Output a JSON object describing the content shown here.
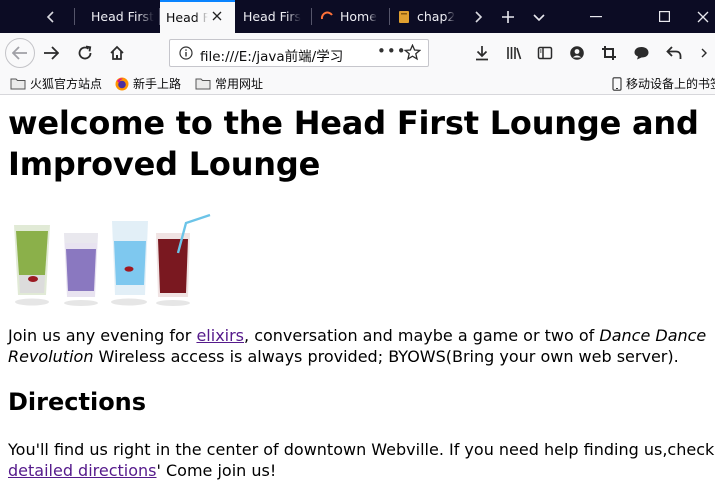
{
  "browser": {
    "tabs": [
      {
        "label": "Head First",
        "active": false
      },
      {
        "label": "Head F",
        "active": true
      },
      {
        "label": "Head Firs",
        "active": false
      },
      {
        "label": "Home",
        "active": false,
        "favicon": "loading-spinner-icon"
      },
      {
        "label": "chap2",
        "active": false,
        "favicon": "book-icon"
      }
    ],
    "url": "file:///E:/java前端/学习",
    "url_overflow": "•••",
    "bookmarks": [
      {
        "label": "火狐官方站点",
        "icon": "folder-icon"
      },
      {
        "label": "新手上路",
        "icon": "firefox-icon"
      },
      {
        "label": "常用网址",
        "icon": "folder-icon"
      }
    ],
    "mobile_bookmarks": "移动设备上的书签",
    "colors": {
      "tabbar": "#0c0c24",
      "accent": "#0a84ff",
      "link": "#551a8b"
    }
  },
  "page": {
    "heading": "welcome to the Head First Lounge and Improved Lounge",
    "image_alt": "drinks",
    "p1": {
      "before_link": "Join us any evening for ",
      "link": "elixirs",
      "after_link": ", conversation and maybe a game or two of ",
      "emphasis": "Dance Dance Revolution",
      "line1_em": "Dance Dance",
      "line2_em": "Revolution",
      "tail": " Wireless access is always provided; BYOWS(Bring your own web server)."
    },
    "directions_heading": "Directions",
    "p2": {
      "line1": "You'll find us right in the center of downtown Webville. If you need help finding us,check out our",
      "link": "detailed directions",
      "after_link": "' Come join us!"
    }
  }
}
